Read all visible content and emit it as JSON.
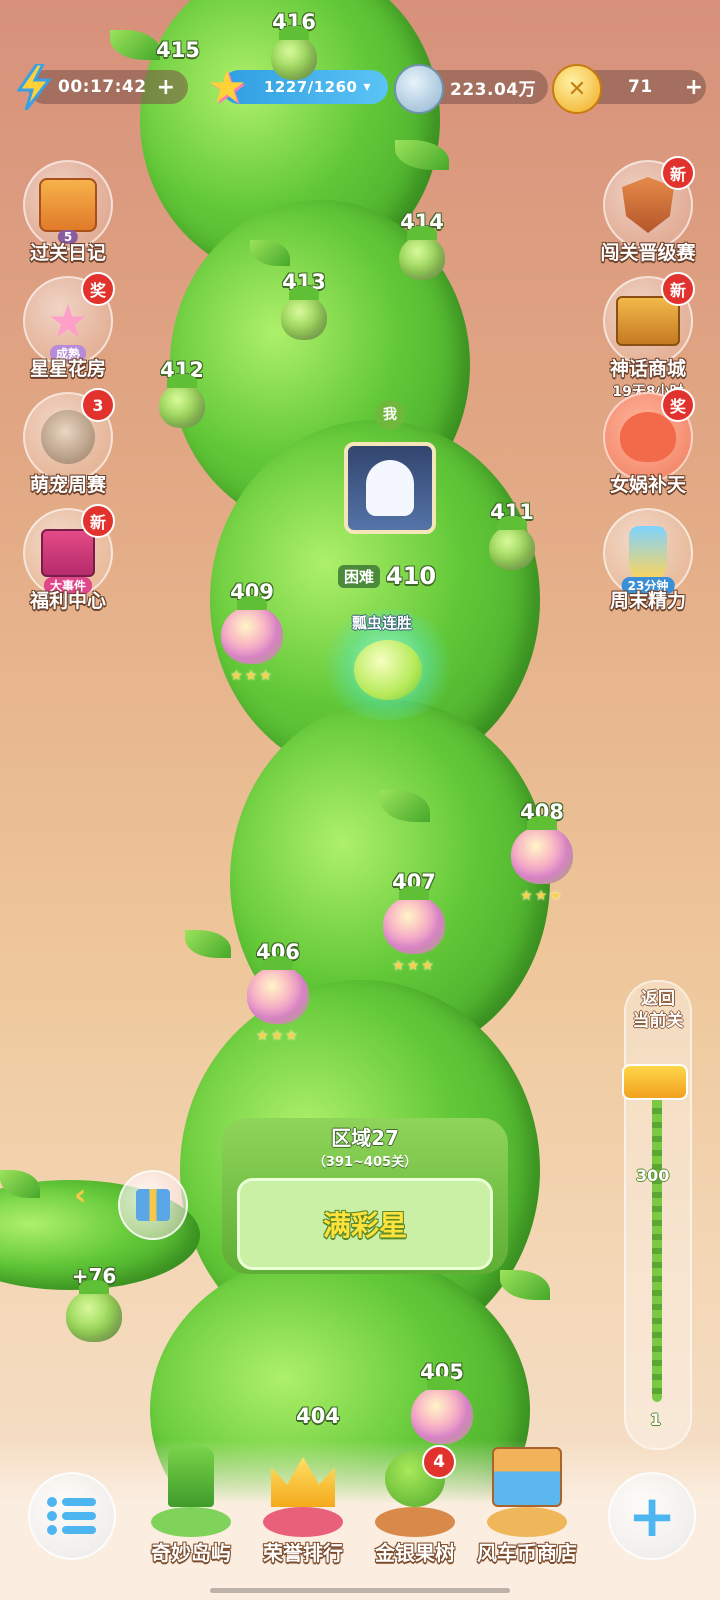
{
  "topbar": {
    "energy_timer": "00:17:42",
    "star_progress": "1227/1260",
    "silver": "223.04万",
    "gold": "71",
    "energy_add": "+",
    "gold_add": "+",
    "dropdown_glyph": "▾"
  },
  "left_menu": [
    {
      "label": "过关日记",
      "sub": "5",
      "badge": ""
    },
    {
      "label": "星星花房",
      "sub": "成熟",
      "badge": "奖"
    },
    {
      "label": "萌宠周赛",
      "sub": "",
      "badge": "3"
    },
    {
      "label": "福利中心",
      "sub": "大事件",
      "badge": "新"
    }
  ],
  "right_menu": [
    {
      "label": "闯关晋级赛",
      "sub": "",
      "badge": "新"
    },
    {
      "label": "神话商城",
      "sub": "19天8小时",
      "badge": "新"
    },
    {
      "label": "女娲补天",
      "sub": "",
      "badge": "奖"
    },
    {
      "label": "周末精力",
      "sub": "23分钟",
      "badge": ""
    }
  ],
  "levels": {
    "l416": "416",
    "l415": "415",
    "l414": "414",
    "l413": "413",
    "l412": "412",
    "l411": "411",
    "l409": "409",
    "l408": "408",
    "l407": "407",
    "l406": "406",
    "l405": "405",
    "l404": "404"
  },
  "current": {
    "me": "我",
    "difficulty": "困难",
    "level": "410",
    "event": "瓢虫连胜"
  },
  "stars_glyph": "★★★",
  "region": {
    "title": "区域27",
    "range": "（391~405关）",
    "status": "满彩星"
  },
  "bonus": "+76",
  "back_arrow": "‹",
  "scroll": {
    "return_label_1": "返回",
    "return_label_2": "当前关",
    "mark_300": "300",
    "mark_1": "1"
  },
  "bottom_nav": [
    {
      "label": "奇妙岛屿",
      "badge": ""
    },
    {
      "label": "荣誉排行",
      "badge": ""
    },
    {
      "label": "金银果树",
      "badge": "4"
    },
    {
      "label": "风车币商店",
      "badge": ""
    }
  ],
  "plus_glyph": "+"
}
